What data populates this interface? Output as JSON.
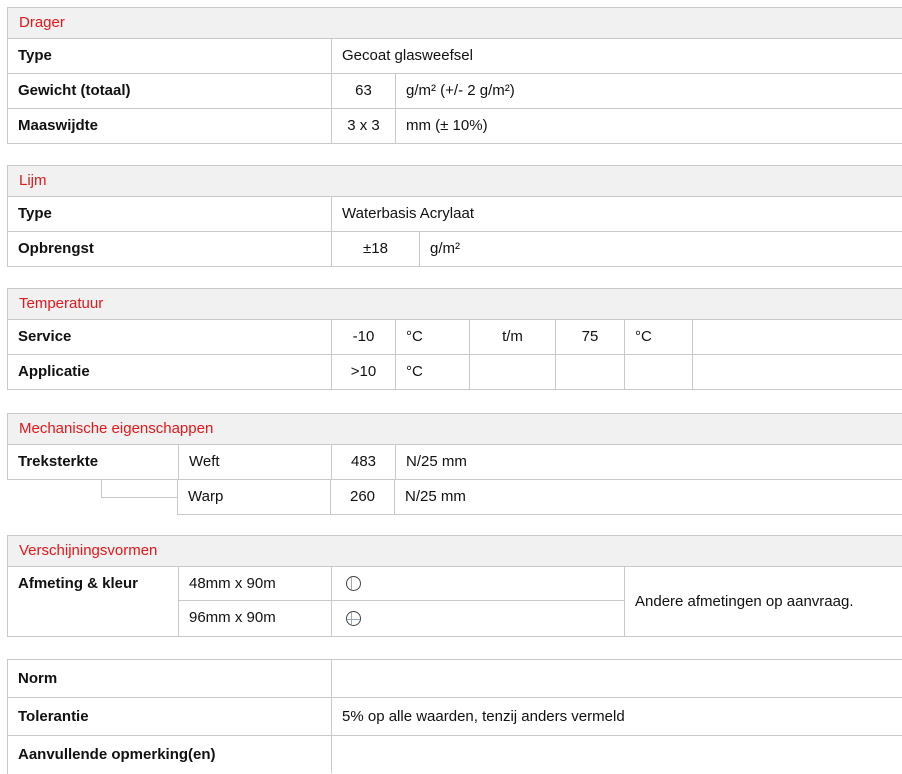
{
  "drager": {
    "title": "Drager",
    "type_label": "Type",
    "type_value": "Gecoat glasweefsel",
    "gewicht_label": "Gewicht (totaal)",
    "gewicht_value": "63",
    "gewicht_unit": "g/m² (+/- 2 g/m²)",
    "maas_label": "Maaswijdte",
    "maas_value": "3 x 3",
    "maas_unit": "mm (± 10%)"
  },
  "lijm": {
    "title": "Lijm",
    "type_label": "Type",
    "type_value": "Waterbasis Acrylaat",
    "opbrengst_label": "Opbrengst",
    "opbrengst_value": "±18",
    "opbrengst_unit": "g/m²"
  },
  "temperatuur": {
    "title": "Temperatuur",
    "service_label": "Service",
    "service_min": "-10",
    "service_min_unit": "°C",
    "service_sep": "t/m",
    "service_max": "75",
    "service_max_unit": "°C",
    "applicatie_label": "Applicatie",
    "applicatie_value": ">10",
    "applicatie_unit": "°C"
  },
  "mechanisch": {
    "title": "Mechanische eigenschappen",
    "label": "Treksterkte",
    "weft_label": "Weft",
    "weft_value": "483",
    "weft_unit": "N/25 mm",
    "warp_label": "Warp",
    "warp_value": "260",
    "warp_unit": "N/25 mm"
  },
  "vormen": {
    "title": "Verschijningsvormen",
    "label": "Afmeting & kleur",
    "size_1": "48mm x 90m",
    "icon_1": "circle-vertical-line-icon",
    "size_2": "96mm x 90m",
    "icon_2": "circle-cross-line-icon",
    "note": "Andere afmetingen op aanvraag."
  },
  "overig": {
    "norm_label": "Norm",
    "norm_value": "",
    "tolerantie_label": "Tolerantie",
    "tolerantie_value": "5% op alle waarden, tenzij anders vermeld",
    "opmerking_label": "Aanvullende opmerking(en)",
    "opmerking_value": ""
  }
}
